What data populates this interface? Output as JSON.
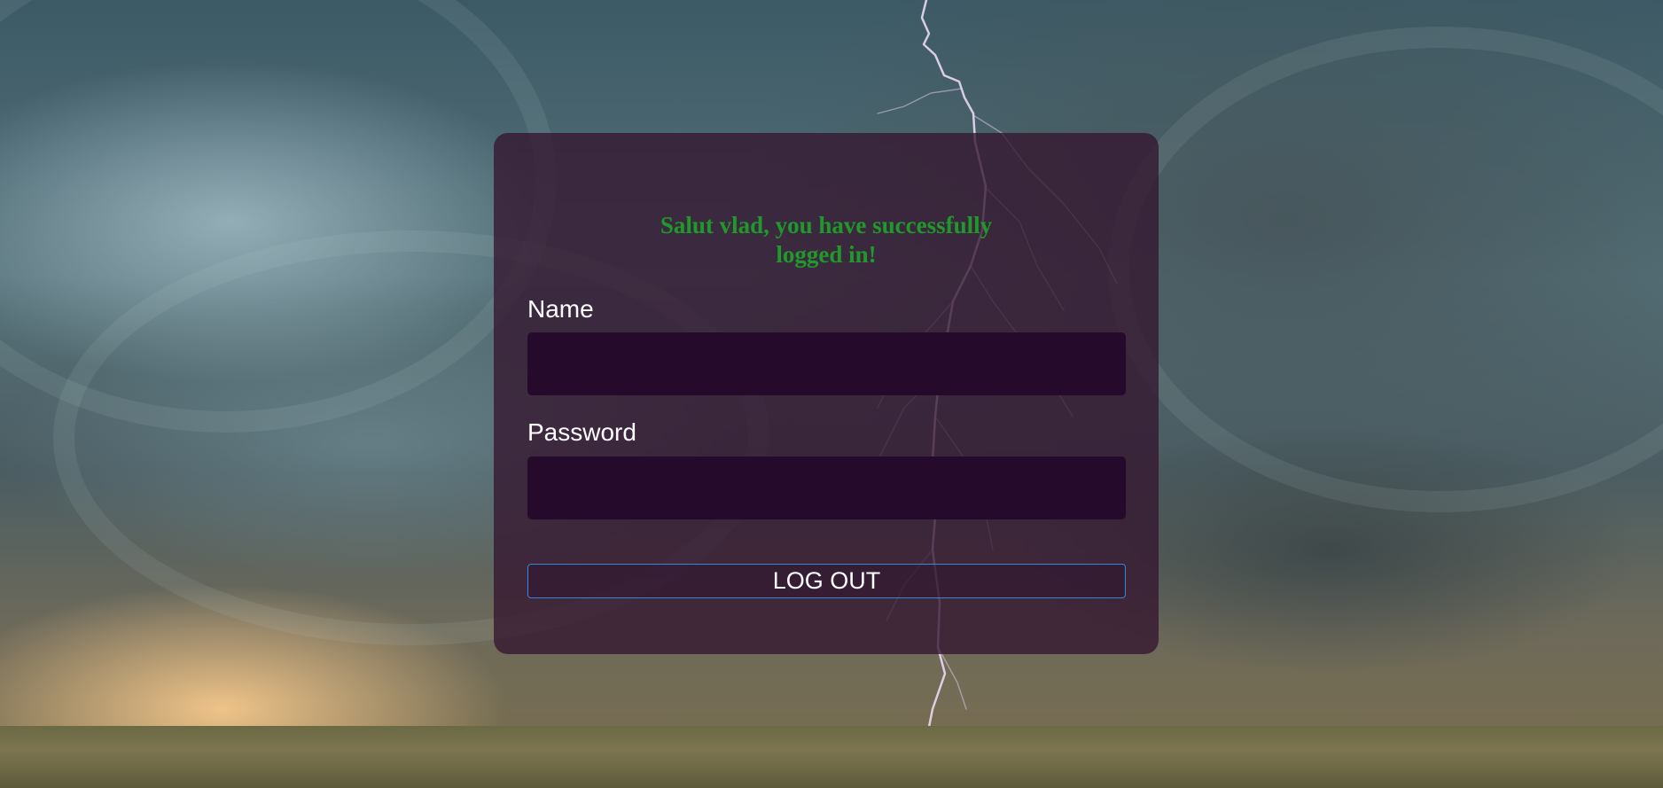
{
  "background": {
    "description_icon": "storm-lightning-background"
  },
  "card": {
    "message": "Salut vlad, you have successfully logged in!",
    "message_color": "#1f9a2a",
    "name_label": "Name",
    "name_value": "",
    "password_label": "Password",
    "password_value": "",
    "logout_label": "LOG OUT",
    "button_border_color": "#3a86d6"
  }
}
